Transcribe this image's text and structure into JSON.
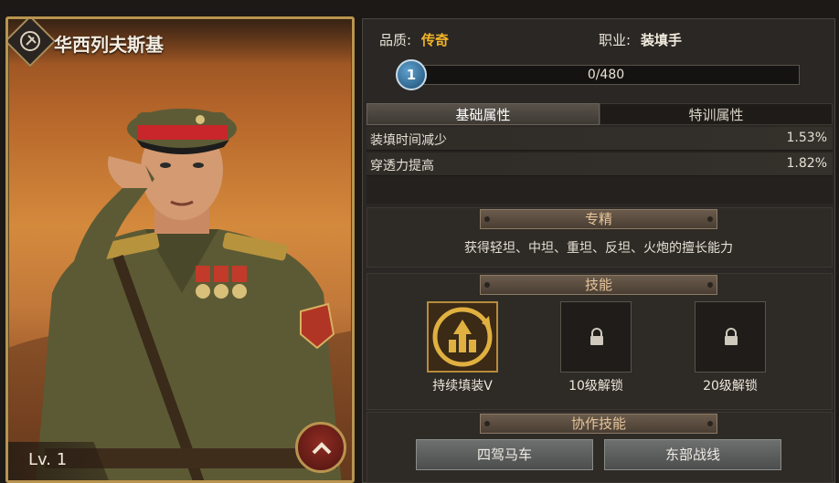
{
  "officer": {
    "name": "华西列夫斯基",
    "level": "Lv. 1"
  },
  "info": {
    "quality_label": "品质:",
    "quality_value": "传奇",
    "class_label": "职业:",
    "class_value": "装填手"
  },
  "experience": {
    "star_count": "1",
    "text": "0/480",
    "progress": 0.0
  },
  "tabs": [
    {
      "label": "基础属性",
      "active": true
    },
    {
      "label": "特训属性",
      "active": false
    }
  ],
  "attributes": [
    {
      "name": "装填时间减少",
      "value": "1.53%"
    },
    {
      "name": "穿透力提高",
      "value": "1.82%"
    }
  ],
  "specialty": {
    "title": "专精",
    "description": "获得轻坦、中坦、重坦、反坦、火炮的擅长能力"
  },
  "skills": {
    "title": "技能",
    "items": [
      {
        "label": "持续填装V",
        "icon": "reload-skill-icon",
        "locked": false
      },
      {
        "label": "10级解锁",
        "icon": "lock-icon",
        "locked": true
      },
      {
        "label": "20级解锁",
        "icon": "lock-icon",
        "locked": true
      }
    ]
  },
  "cooperation": {
    "title": "协作技能",
    "buttons": [
      "四驾马车",
      "东部战线"
    ]
  },
  "colors": {
    "legendary": "#f0b429",
    "accent_gold": "#b9944f",
    "progress_fill": "#5a8ec2"
  }
}
